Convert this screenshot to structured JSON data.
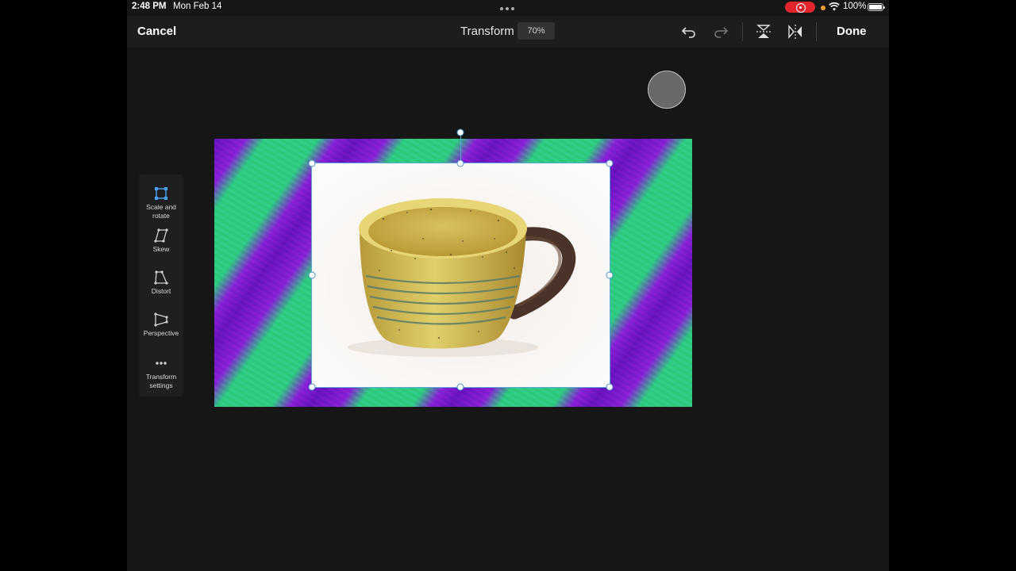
{
  "status_bar": {
    "time": "2:48 PM",
    "date": "Mon Feb 14",
    "battery": "100%"
  },
  "toolbar": {
    "cancel_label": "Cancel",
    "title": "Transform",
    "zoom": "70%",
    "done_label": "Done",
    "icons": [
      "undo-icon",
      "redo-icon",
      "flip-vertical-icon",
      "flip-horizontal-icon"
    ]
  },
  "tools": [
    {
      "label": "Scale and rotate",
      "icon": "scale-rotate-icon",
      "active": true
    },
    {
      "label": "Skew",
      "icon": "skew-icon",
      "active": false
    },
    {
      "label": "Distort",
      "icon": "distort-icon",
      "active": false
    },
    {
      "label": "Perspective",
      "icon": "perspective-icon",
      "active": false
    },
    {
      "label": "Transform settings",
      "icon": "more-icon",
      "active": false
    }
  ],
  "colors": {
    "accent": "#5aa7d8",
    "active_tool": "#4aa3ff",
    "background_green": "#2ecc84",
    "background_purple": "#8a1fd8",
    "record": "#e0252c"
  }
}
